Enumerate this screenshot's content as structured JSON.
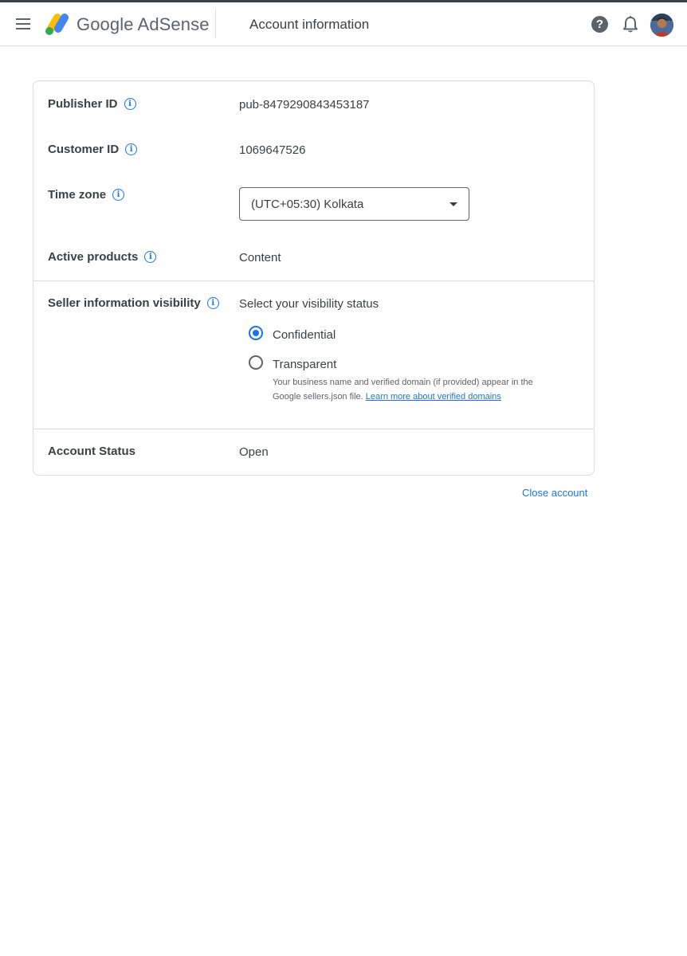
{
  "header": {
    "brand": "Google AdSense",
    "page_title": "Account information",
    "help_glyph": "?"
  },
  "icons": {
    "menu": "menu-icon",
    "logo": "adsense-logo",
    "help": "help-icon",
    "notifications": "bell-icon",
    "account": "avatar",
    "info": "info-icon"
  },
  "colors": {
    "accent": "#1a73e8",
    "logo_yellow": "#fbbc04",
    "logo_blue": "#4285f4",
    "logo_green": "#34a853"
  },
  "account_info": {
    "publisher_id": {
      "label": "Publisher ID",
      "value": "pub-8479290843453187"
    },
    "customer_id": {
      "label": "Customer ID",
      "value": "1069647526"
    },
    "time_zone": {
      "label": "Time zone",
      "selected": "(UTC+05:30) Kolkata"
    },
    "active_products": {
      "label": "Active products",
      "value": "Content"
    },
    "seller_visibility": {
      "label": "Seller information visibility",
      "prompt": "Select your visibility status",
      "options": [
        {
          "label": "Confidential",
          "checked": true
        },
        {
          "label": "Transparent",
          "checked": false
        }
      ],
      "helper_text": "Your business name and verified domain (if provided) appear in the Google sellers.json file.",
      "helper_link": "Learn more about verified domains"
    },
    "account_status": {
      "label": "Account Status",
      "value": "Open"
    }
  },
  "actions": {
    "close_account": "Close account"
  }
}
